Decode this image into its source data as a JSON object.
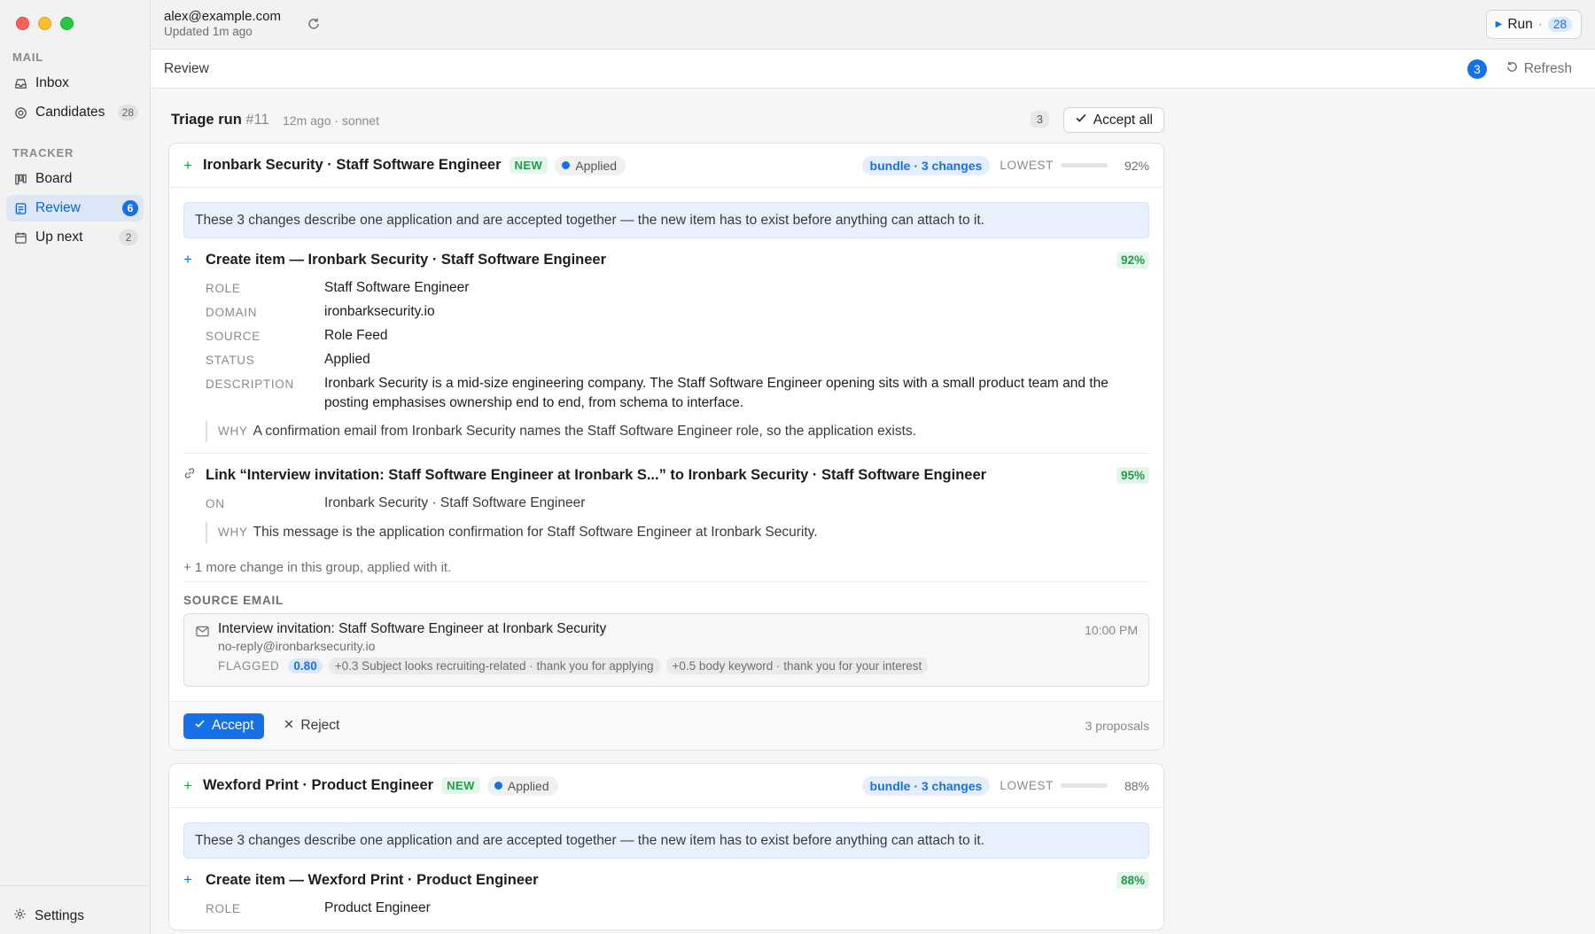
{
  "sidebar": {
    "mail_section": "MAIL",
    "tracker_section": "TRACKER",
    "items": [
      {
        "label": "Inbox",
        "count": ""
      },
      {
        "label": "Candidates",
        "count": "28"
      },
      {
        "label": "Board",
        "count": ""
      },
      {
        "label": "Review",
        "count": "6"
      },
      {
        "label": "Up next",
        "count": "2"
      }
    ],
    "settings_label": "Settings"
  },
  "topbar": {
    "account_email": "alex@example.com",
    "updated": "Updated 1m ago",
    "run_label": "Run",
    "run_sep": "·",
    "run_count": "28"
  },
  "subbar": {
    "title": "Review",
    "badge": "3",
    "refresh_label": "Refresh"
  },
  "run": {
    "title": "Triage run",
    "number": "#11",
    "meta": "12m ago · sonnet",
    "count": "3",
    "accept_all_label": "Accept all"
  },
  "cards": [
    {
      "title": "Ironbark Security · Staff Software Engineer",
      "new_label": "NEW",
      "status": "Applied",
      "bundle": "bundle · 3 changes",
      "lowest_label": "LOWEST",
      "confidence": 0.92,
      "confidence_label": "92%",
      "notice": "These 3 changes describe one application and are accepted together — the new item has to exist before anything can attach to it.",
      "create": {
        "title": "Create item — Ironbark Security · Staff Software Engineer",
        "pct": "92%",
        "fields": [
          {
            "k": "ROLE",
            "v": "Staff Software Engineer"
          },
          {
            "k": "DOMAIN",
            "v": "ironbarksecurity.io"
          },
          {
            "k": "SOURCE",
            "v": "Role Feed"
          },
          {
            "k": "STATUS",
            "v": "Applied"
          },
          {
            "k": "DESCRIPTION",
            "v": "Ironbark Security is a mid-size engineering company. The Staff Software Engineer opening sits with a small product team and the posting emphasises ownership end to end, from schema to interface."
          }
        ],
        "why_label": "WHY",
        "why": "A confirmation email from Ironbark Security names the Staff Software Engineer role, so the application exists."
      },
      "link": {
        "title": "Link “Interview invitation: Staff Software Engineer at Ironbark S...” to Ironbark Security · Staff Software Engineer",
        "pct": "95%",
        "on_label": "ON",
        "on": "Ironbark Security · Staff Software Engineer",
        "why_label": "WHY",
        "why": "This message is the application confirmation for Staff Software Engineer at Ironbark Security."
      },
      "more": "+ 1 more change in this group, applied with it.",
      "source_label": "SOURCE EMAIL",
      "email": {
        "subject": "Interview invitation: Staff Software Engineer at Ironbark Security",
        "from": "no-reply@ironbarksecurity.io",
        "time": "10:00 PM",
        "flagged_label": "FLAGGED",
        "score": "0.80",
        "chips": [
          "+0.3 Subject looks recruiting-related · thank you for applying",
          "+0.5 body keyword · thank you for your interest"
        ]
      },
      "accept_label": "Accept",
      "reject_label": "Reject",
      "proposals": "3 proposals"
    },
    {
      "title": "Wexford Print · Product Engineer",
      "new_label": "NEW",
      "status": "Applied",
      "bundle": "bundle · 3 changes",
      "lowest_label": "LOWEST",
      "confidence": 0.88,
      "confidence_label": "88%",
      "notice": "These 3 changes describe one application and are accepted together — the new item has to exist before anything can attach to it.",
      "create": {
        "title": "Create item — Wexford Print · Product Engineer",
        "pct": "88%",
        "fields": [
          {
            "k": "ROLE",
            "v": "Product Engineer"
          }
        ]
      }
    }
  ],
  "colors": {
    "accent": "#1671e8",
    "success": "#2ca24f",
    "sidebar_bg": "#f2f2f3"
  }
}
